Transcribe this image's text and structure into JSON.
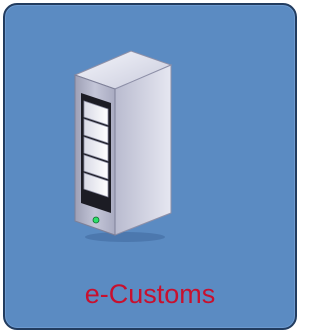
{
  "tile": {
    "label": "e-Customs",
    "icon": "server-tower-icon",
    "background_color": "#5b8bc2",
    "border_color": "#223c5f",
    "label_color": "#c8102e"
  }
}
